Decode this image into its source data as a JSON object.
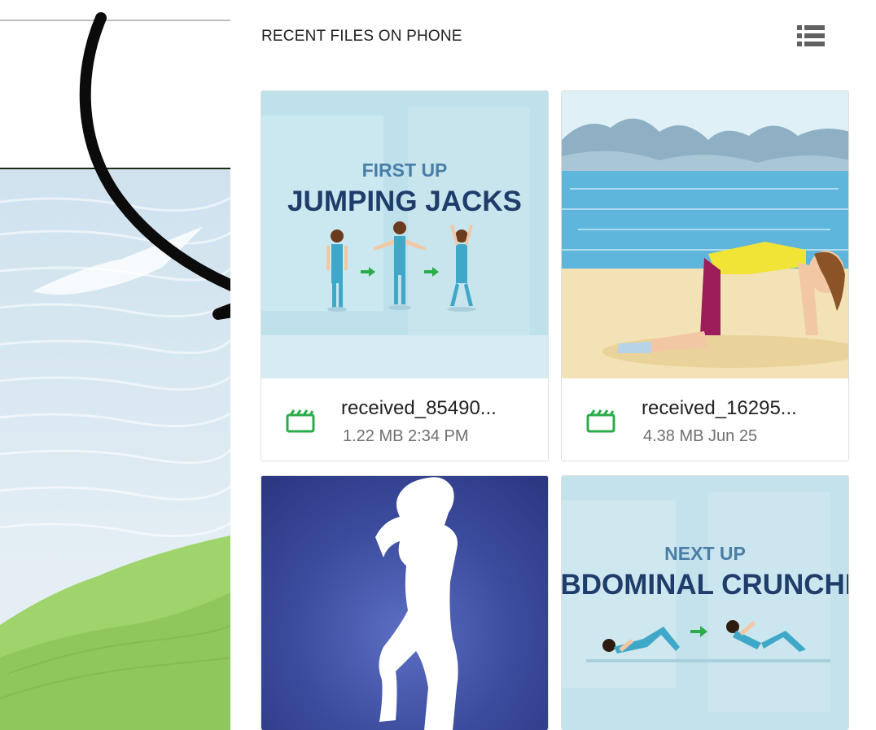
{
  "section": {
    "title": "RECENT FILES ON PHONE",
    "view_toggle_icon": "list-view-icon"
  },
  "files": [
    {
      "name": "received_85490...",
      "size": "1.22 MB",
      "time": "2:34 PM",
      "icon": "video-clapper-icon",
      "thumb_caption_small": "FIRST UP",
      "thumb_caption_big": "JUMPING JACKS"
    },
    {
      "name": "received_16295...",
      "size": "4.38 MB",
      "time": "Jun 25",
      "icon": "video-clapper-icon"
    },
    {
      "thumb": "dance-silhouette"
    },
    {
      "thumb_caption_small": "NEXT UP",
      "thumb_caption_big": "BDOMINAL CRUNCHI"
    }
  ],
  "colors": {
    "accent_green": "#2bab4a",
    "caption_dark": "#1f3d6b",
    "caption_light": "#4a7ea6"
  }
}
